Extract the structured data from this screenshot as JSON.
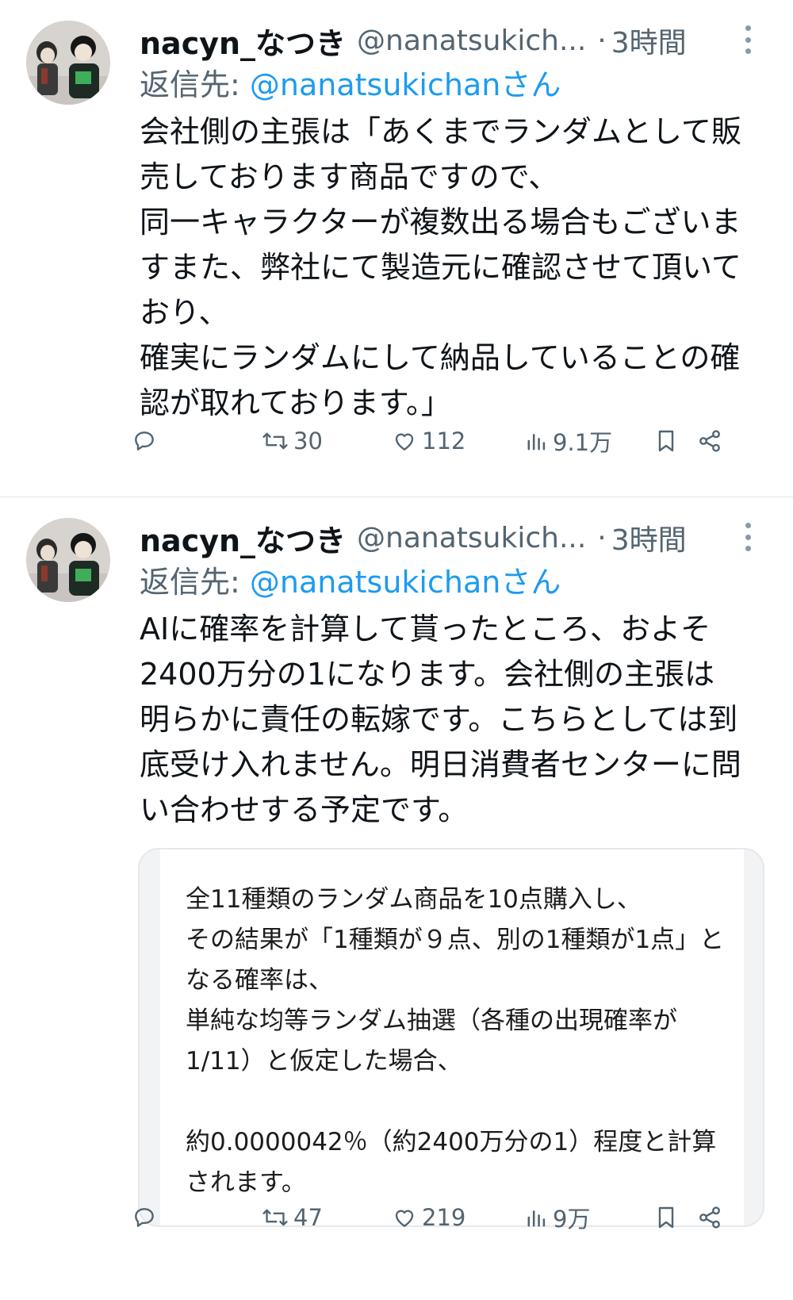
{
  "tweets": [
    {
      "display_name": "nacyn_なつき",
      "handle": "@nanatsukich...",
      "separator": "·",
      "time": "3時間",
      "reply_label": "返信先: ",
      "reply_mention": "@nanatsukichanさん",
      "text": "会社側の主張は「あくまでランダムとして販売しております商品ですので、\n同一キャラクターが複数出る場合もございますまた、弊社にて製造元に確認させて頂いており、\n確実にランダムにして納品していることの確認が取れております。」",
      "retweets": "30",
      "likes": "112",
      "views": "9.1万"
    },
    {
      "display_name": "nacyn_なつき",
      "handle": "@nanatsukich...",
      "separator": "·",
      "time": "3時間",
      "reply_label": "返信先: ",
      "reply_mention": "@nanatsukichanさん",
      "text": "AIに確率を計算して貰ったところ、およそ2400万分の1になります。会社側の主張は明らかに責任の転嫁です。こちらとしては到底受け入れません。明日消費者センターに問い合わせする予定です。",
      "quote_text": "全11種類のランダム商品を10点購入し、\nその結果が「1種類が９点、別の1種類が1点」となる確率は、\n単純な均等ランダム抽選（各種の出現確率が1/11）と仮定した場合、\n\n約0.0000042％（約2400万分の1）程度と計算されます。",
      "retweets": "47",
      "likes": "219",
      "views": "9万"
    }
  ],
  "icons": [
    "reply-icon",
    "retweet-icon",
    "like-icon",
    "views-icon",
    "bookmark-icon",
    "share-icon",
    "more-icon"
  ],
  "colors": {
    "text": "#0f1419",
    "secondary": "#536471",
    "mention": "#1d9bf0",
    "divider": "#e3e6e9"
  }
}
